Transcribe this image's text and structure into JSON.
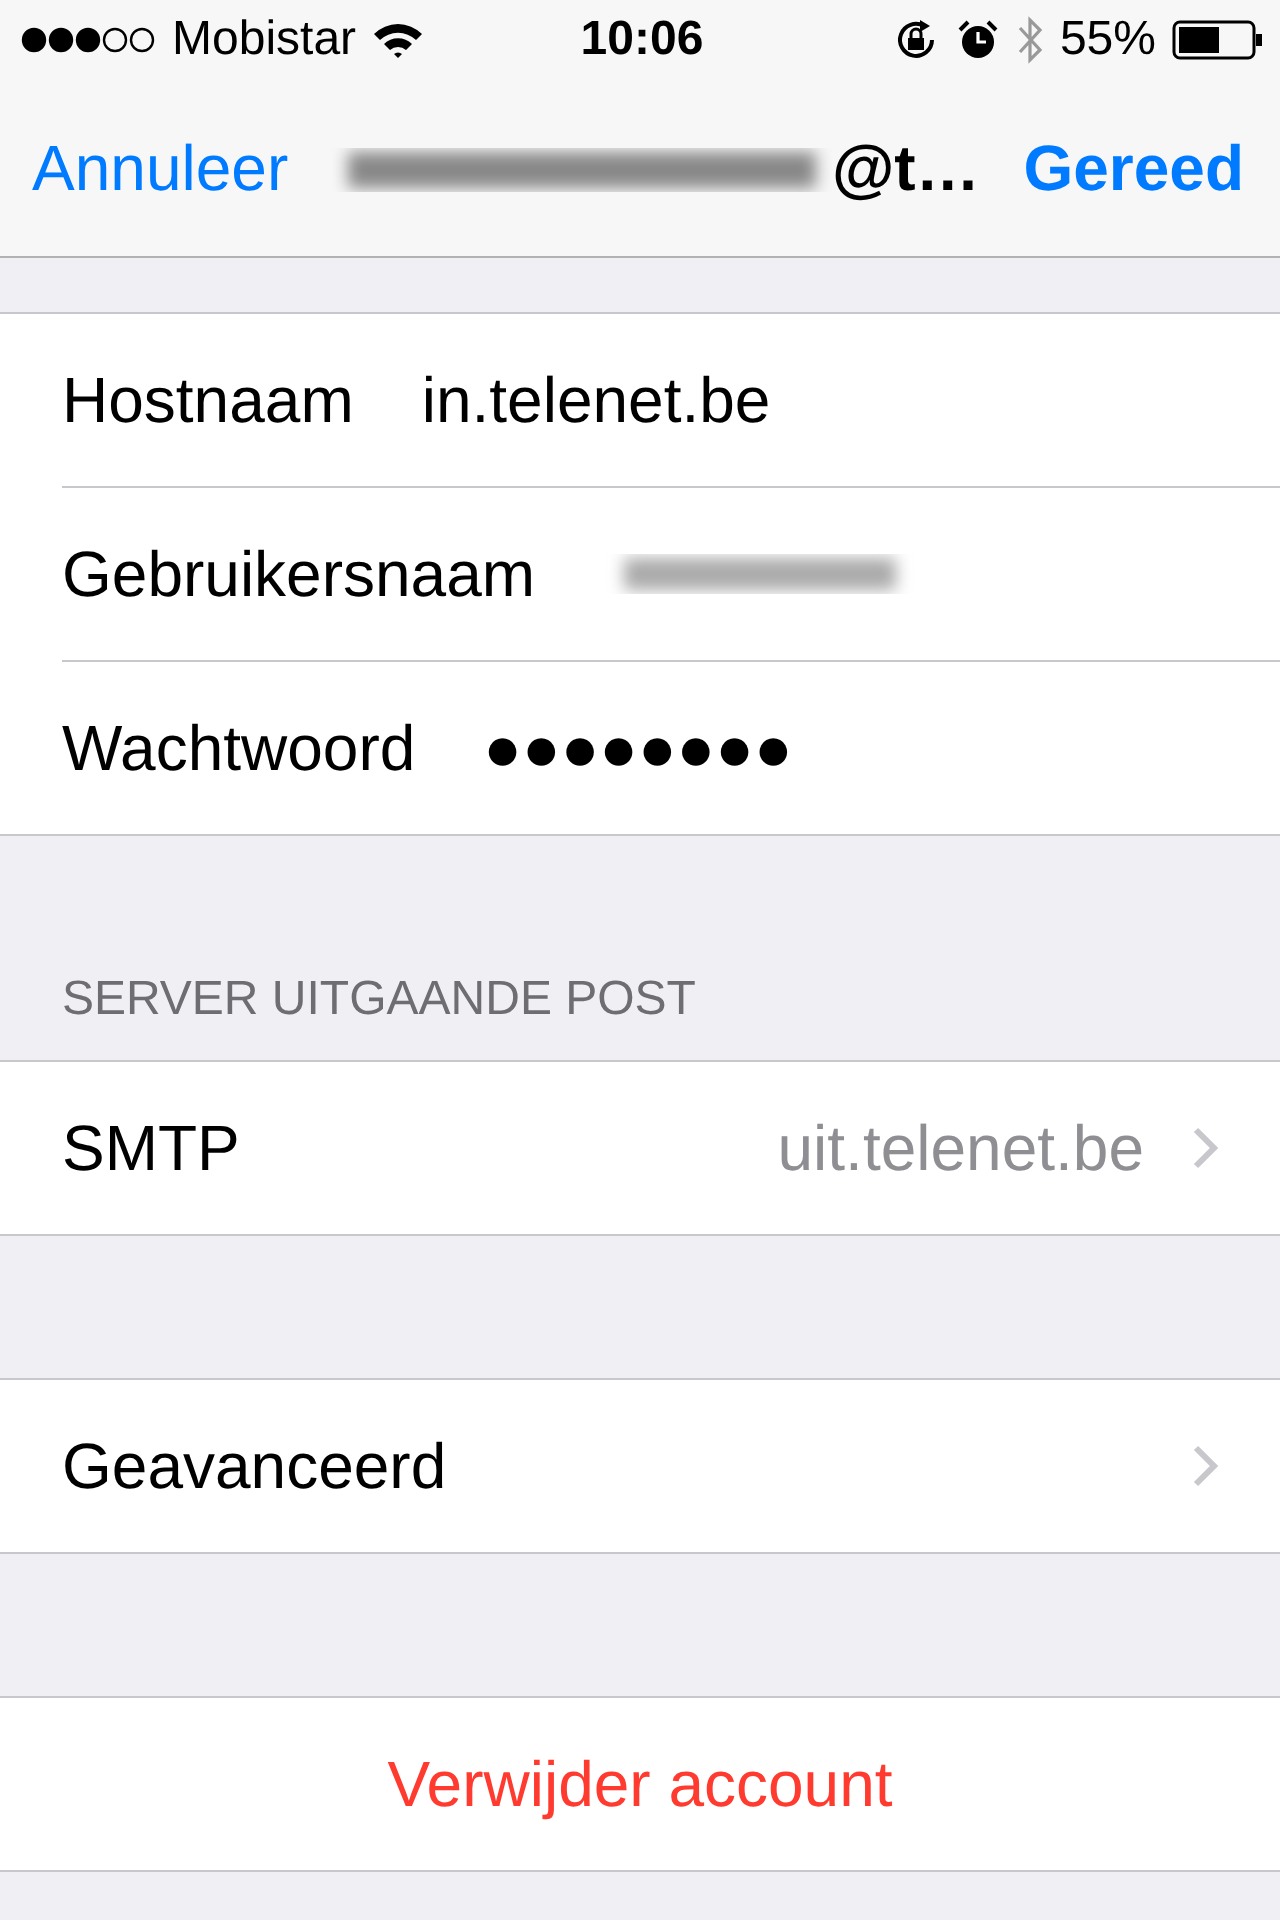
{
  "status_bar": {
    "carrier": "Mobistar",
    "time": "10:06",
    "battery": "55%"
  },
  "nav": {
    "cancel": "Annuleer",
    "title": "@t…",
    "title_obscured_prefix": true,
    "done": "Gereed"
  },
  "sections": [
    {
      "rows": [
        {
          "kind": "field",
          "label": "Hostnaam",
          "value": "in.telenet.be"
        },
        {
          "kind": "obscured",
          "label": "Gebruikersnaam"
        },
        {
          "kind": "field",
          "label": "Wachtwoord",
          "value": "●●●●●●●●"
        }
      ]
    },
    {
      "header": "SERVER UITGAANDE POST",
      "rows": [
        {
          "kind": "link",
          "label": "SMTP",
          "value": "uit.telenet.be"
        }
      ]
    },
    {
      "rows": [
        {
          "kind": "link",
          "label": "Geavanceerd"
        }
      ]
    },
    {
      "rows": [
        {
          "kind": "destructive",
          "label": "Verwijder account"
        }
      ]
    }
  ]
}
